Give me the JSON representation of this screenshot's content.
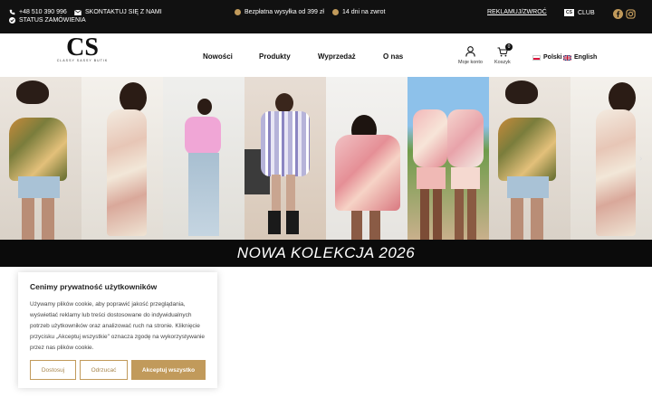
{
  "topbar": {
    "phone": "+48 510 390 996",
    "contact": "SKONTAKTUJ SIĘ Z NAMI",
    "order_status": "STATUS ZAMÓWIENIA",
    "shipping": "Bezpłatna wysyłka od 399 zł",
    "returns": "14 dni na zwrot",
    "complaints": "REKLAMUJ/ZWROĆ",
    "club_badge": "CS",
    "club": "CLUB"
  },
  "header": {
    "logo_letters": "CS",
    "logo_tagline": "CLASSY SASSY BUTIK",
    "nav": [
      "Nowości",
      "Produkty",
      "Wyprzedaż",
      "O nas"
    ],
    "account_label": "Moje konto",
    "cart_label": "Koszyk",
    "cart_count": "0",
    "lang_pl": "Polski",
    "lang_en": "English"
  },
  "banner": {
    "collection_text": "NOWA KOLEKCJA 2026"
  },
  "cookie": {
    "title": "Cenimy prywatność użytkowników",
    "text": "Używamy plików cookie, aby poprawić jakość przeglądania, wyświetlać reklamy lub treści dostosowane do indywidualnych potrzeb użytkowników oraz analizować ruch na stronie. Kliknięcie przycisku „Akceptuj wszystkie\" oznacza zgodę na wykorzystywanie przez nas plików cookie.",
    "customize": "Dostosuj",
    "reject": "Odrzucać",
    "accept": "Akceptuj wszystko"
  },
  "colors": {
    "topbar_bg": "#111111",
    "accent_gold": "#c19a5b",
    "collection_bar": "#0b0b0b"
  }
}
